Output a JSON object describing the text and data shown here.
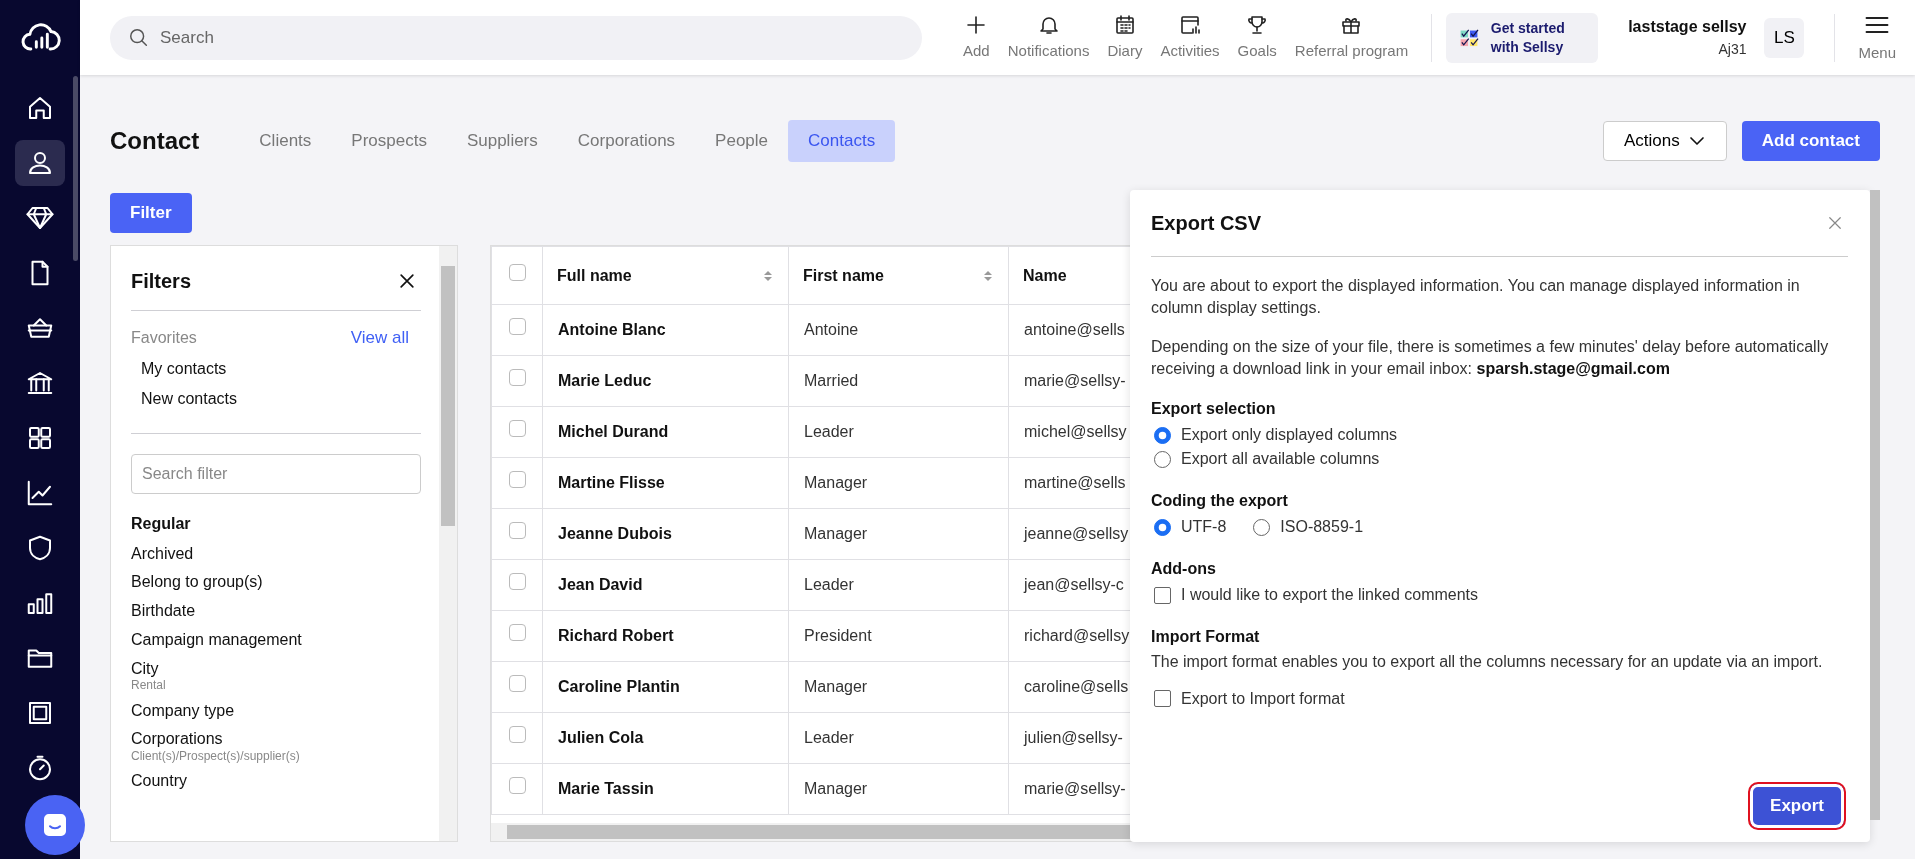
{
  "sidebar": {
    "items": [
      {
        "selected": false
      },
      {
        "selected": true
      },
      {
        "selected": false
      },
      {
        "selected": false
      },
      {
        "selected": false
      },
      {
        "selected": false
      },
      {
        "selected": false
      },
      {
        "selected": false
      },
      {
        "selected": false
      },
      {
        "selected": false
      },
      {
        "selected": false
      },
      {
        "selected": false
      },
      {
        "selected": false
      }
    ]
  },
  "top_bar": {
    "search": {
      "placeholder": "Search"
    },
    "shortcuts": [
      "Add",
      "Notifications",
      "Diary",
      "Activities",
      "Goals",
      "Referral program"
    ],
    "promo": "Get started with Sellsy",
    "user": {
      "name": "laststage sellsy",
      "account": "Aj31",
      "initials": "LS"
    },
    "menu": "Menu"
  },
  "page": {
    "title": "Contact",
    "tabs": [
      {
        "label": "Clients",
        "selected": false
      },
      {
        "label": "Prospects",
        "selected": false
      },
      {
        "label": "Suppliers",
        "selected": false
      },
      {
        "label": "Corporations",
        "selected": false
      },
      {
        "label": "People",
        "selected": false
      },
      {
        "label": "Contacts",
        "selected": true
      }
    ],
    "actions_button": "Actions",
    "add_button": "Add contact",
    "filter_button": "Filter"
  },
  "filters": {
    "title": "Filters",
    "favorites_label": "Favorites",
    "view_all": "View all",
    "favorites": [
      "My contacts",
      "New contacts"
    ],
    "search": {
      "placeholder": "Search filter"
    },
    "section": "Regular",
    "items": [
      {
        "label": "Archived"
      },
      {
        "label": "Belong to group(s)"
      },
      {
        "label": "Birthdate"
      },
      {
        "label": "Campaign management"
      },
      {
        "label": "City",
        "note": "Rental"
      },
      {
        "label": "Company type"
      },
      {
        "label": "Corporations",
        "note": "Client(s)/Prospect(s)/supplier(s)"
      },
      {
        "label": "Country"
      }
    ]
  },
  "table": {
    "header_checked": false,
    "columns": [
      {
        "label": "Full name",
        "sortable": true
      },
      {
        "label": "First name",
        "sortable": true
      },
      {
        "label": "Name"
      }
    ],
    "rows": [
      {
        "checked": false,
        "cells": [
          "Antoine Blanc",
          "Antoine",
          "antoine@sells"
        ]
      },
      {
        "checked": false,
        "cells": [
          "Marie Leduc",
          "Married",
          "marie@sellsy-"
        ]
      },
      {
        "checked": false,
        "cells": [
          "Michel Durand",
          "Leader",
          "michel@sellsy"
        ]
      },
      {
        "checked": false,
        "cells": [
          "Martine Flisse",
          "Manager",
          "martine@sells"
        ]
      },
      {
        "checked": false,
        "cells": [
          "Jeanne Dubois",
          "Manager",
          "jeanne@sellsy"
        ]
      },
      {
        "checked": false,
        "cells": [
          "Jean David",
          "Leader",
          "jean@sellsy-c"
        ]
      },
      {
        "checked": false,
        "cells": [
          "Richard Robert",
          "President",
          "richard@sellsy"
        ]
      },
      {
        "checked": false,
        "cells": [
          "Caroline Plantin",
          "Manager",
          "caroline@sells"
        ]
      },
      {
        "checked": false,
        "cells": [
          "Julien Cola",
          "Leader",
          "julien@sellsy-"
        ]
      },
      {
        "checked": false,
        "cells": [
          "Marie Tassin",
          "Manager",
          "marie@sellsy-"
        ]
      }
    ]
  },
  "export_dialog": {
    "title": "Export CSV",
    "paragraphs": [
      "You are about to export the displayed information. You can manage displayed information in column display settings.",
      "Depending on the size of your file, there is sometimes a few minutes' delay before automatically receiving a download link in your email inbox: **sparsh.stage@gmail.com**"
    ],
    "groups": [
      {
        "title": "Export selection",
        "kind": "radio-stack",
        "options": [
          {
            "label": "Export only displayed columns",
            "selected": true
          },
          {
            "label": "Export all available columns",
            "selected": false
          }
        ]
      },
      {
        "title": "Coding the export",
        "kind": "radio-inline",
        "options": [
          {
            "label": "UTF-8",
            "selected": true
          },
          {
            "label": "ISO-8859-1",
            "selected": false
          }
        ]
      },
      {
        "title": "Add-ons",
        "kind": "checkbox",
        "options": [
          {
            "label": "I would like to export the linked comments",
            "checked": false
          }
        ]
      },
      {
        "title": "Import Format",
        "kind": "checkbox",
        "description": "The import format enables you to export all the columns necessary for an update via an import.",
        "options": [
          {
            "label": "Export to Import format",
            "checked": false
          }
        ]
      }
    ],
    "export_button": {
      "label": "Export",
      "focused": true
    }
  }
}
